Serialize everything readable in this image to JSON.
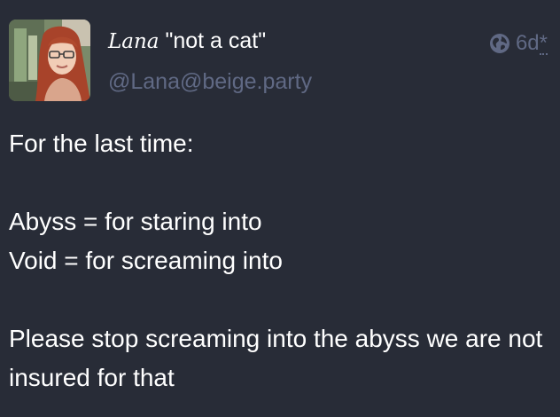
{
  "status": {
    "author": {
      "display_name_fancy": "Lana",
      "display_name_rest": " \"not a cat\"",
      "handle": "@Lana@beige.party"
    },
    "visibility_icon": "globe-icon",
    "timestamp": "6d",
    "edited_marker": "*",
    "content": {
      "paragraph_1": "For the last time:",
      "paragraph_2_line_1": "Abyss = for staring into",
      "paragraph_2_line_2": "Void = for screaming into",
      "paragraph_3": "Please stop screaming into the abyss we are not insured for that"
    }
  },
  "colors": {
    "background": "#282c37",
    "text": "#ffffff",
    "muted": "#606984"
  }
}
